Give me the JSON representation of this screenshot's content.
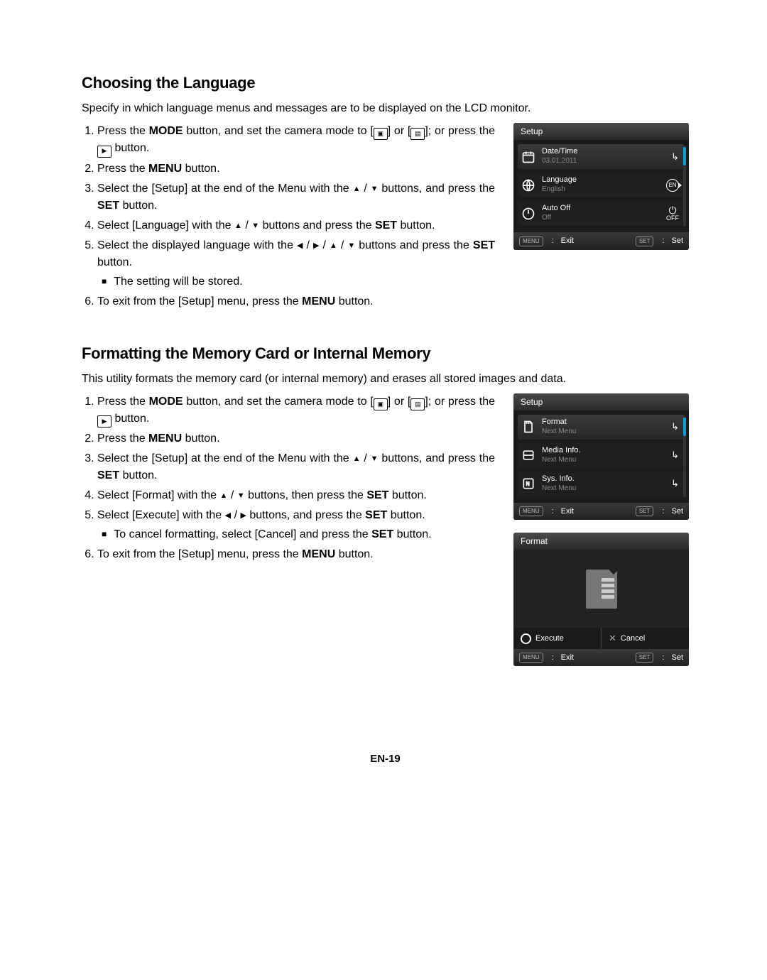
{
  "section1": {
    "heading": "Choosing the Language",
    "intro": "Specify in which language menus and messages are to be displayed on the LCD monitor.",
    "steps": {
      "s1a": "Press the ",
      "s1b": " button, and set the camera mode to [",
      "s1c": "] or [",
      "s1d": "]; or press the ",
      "s1e": " button.",
      "s2a": "Press the ",
      "s2b": " button.",
      "s3a": "Select the [Setup] at the end of the Menu with the ",
      "s3b": " buttons, and press the ",
      "s3c": " button.",
      "s4a": "Select [Language] with the ",
      "s4b": " buttons and press the ",
      "s4c": " button.",
      "s5a": "Select the displayed language with the ",
      "s5b": " buttons and press the ",
      "s5c": " button.",
      "s5sub": "The setting will be stored.",
      "s6a": "To exit from the [Setup] menu, press the ",
      "s6b": " button."
    },
    "lcd": {
      "title": "Setup",
      "rows": [
        {
          "label": "Date/Time",
          "value": "03.01.2011",
          "right": "arrow"
        },
        {
          "label": "Language",
          "value": "English",
          "right": "en"
        },
        {
          "label": "Auto Off",
          "value": "Off",
          "right": "pwroff"
        }
      ],
      "foot_exit": "Exit",
      "foot_set": "Set",
      "badge_menu": "MENU",
      "badge_set": "SET"
    }
  },
  "section2": {
    "heading": "Formatting the Memory Card or Internal Memory",
    "intro": "This utility formats the memory card (or internal memory) and erases all stored images and data.",
    "steps": {
      "s1a": "Press the ",
      "s1b": " button, and set the camera mode to [",
      "s1c": "] or [",
      "s1d": "]; or press the ",
      "s1e": " button.",
      "s2a": "Press the ",
      "s2b": " button.",
      "s3a": "Select the [Setup] at the end of the Menu with the ",
      "s3b": " buttons, and press the ",
      "s3c": " button.",
      "s4a": "Select [Format] with the ",
      "s4b": " buttons, then press the ",
      "s4c": " button.",
      "s5a": "Select [Execute] with the ",
      "s5b": " buttons, and press the ",
      "s5c": " button.",
      "s5sub": "To cancel formatting, select [Cancel] and press the ",
      "s5sub2": " button.",
      "s6a": "To exit from the [Setup] menu, press the ",
      "s6b": " button."
    },
    "lcd1": {
      "title": "Setup",
      "rows": [
        {
          "label": "Format",
          "value": "Next Menu"
        },
        {
          "label": "Media Info.",
          "value": "Next Menu"
        },
        {
          "label": "Sys. Info.",
          "value": "Next Menu"
        }
      ],
      "foot_exit": "Exit",
      "foot_set": "Set",
      "badge_menu": "MENU",
      "badge_set": "SET"
    },
    "lcd2": {
      "title": "Format",
      "exec": "Execute",
      "cancel": "Cancel",
      "foot_exit": "Exit",
      "foot_set": "Set",
      "badge_menu": "MENU",
      "badge_set": "SET"
    }
  },
  "buttons": {
    "mode": "MODE",
    "menu": "MENU",
    "set": "SET"
  },
  "glyphs": {
    "up": "▲",
    "down": "▼",
    "left": "◀",
    "right": "▶",
    "slash": " / "
  },
  "page": "EN-19"
}
